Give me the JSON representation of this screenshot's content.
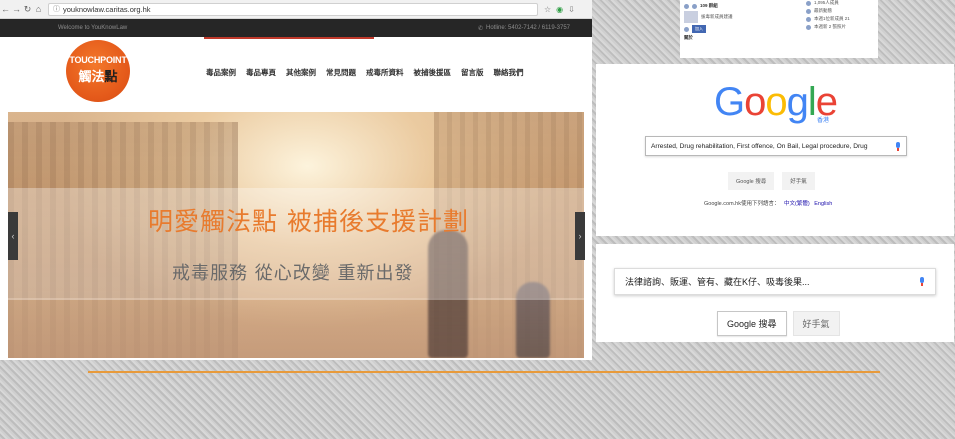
{
  "browser": {
    "url": "youknowlaw.caritas.org.hk",
    "site_top": {
      "welcome": "Welcome to YouKnowLaw",
      "hotline": "Hotline: 5402-7142 / 6119-3757"
    },
    "logo": {
      "en_left": "TOUCH",
      "en_right": "POINT",
      "zh_left": "觸法",
      "zh_right": "點"
    },
    "nav": [
      "毒品案例",
      "毒品專頁",
      "其他案例",
      "常見問題",
      "戒毒所資料",
      "被捕後援區",
      "留言版",
      "聯絡我們"
    ],
    "hero": {
      "title": "明愛觸法點 被捕後支援計劃",
      "subtitle": "戒毒服務 從心改變 重新出發"
    },
    "arrows": {
      "left": "‹",
      "right": "›"
    }
  },
  "facebook": {
    "left_items": [
      "109 群組",
      "拔毒新成員建議",
      "加入"
    ],
    "bottom_label": "關於",
    "right_items": [
      "1,095人成員",
      "最新動態",
      "本週1位新成員 21",
      "本週新 2 張照片"
    ]
  },
  "google1": {
    "logo_letters": [
      "G",
      "o",
      "o",
      "g",
      "l",
      "e"
    ],
    "region": "香港",
    "query": "Arrested, Drug rehabilitation, First offence, On Bail, Legal procedure, Drug",
    "search_button": "Google 搜尋",
    "lucky_button": "好手氣",
    "lang_prefix": "Google.com.hk使用下列語言：",
    "lang_zh": "中文(繁體)",
    "lang_en": "English"
  },
  "google2": {
    "query": "法律諮詢、販運、管有、藏在K仔、吸毒後果...",
    "search_button": "Google 搜尋",
    "lucky_button": "好手氣"
  },
  "colors": {
    "accent_orange": "#e87b2e",
    "google_blue": "#4285f4",
    "google_red": "#ea4335",
    "google_yellow": "#fbbc05",
    "google_green": "#34a853",
    "divider_orange": "#e89a3a"
  }
}
